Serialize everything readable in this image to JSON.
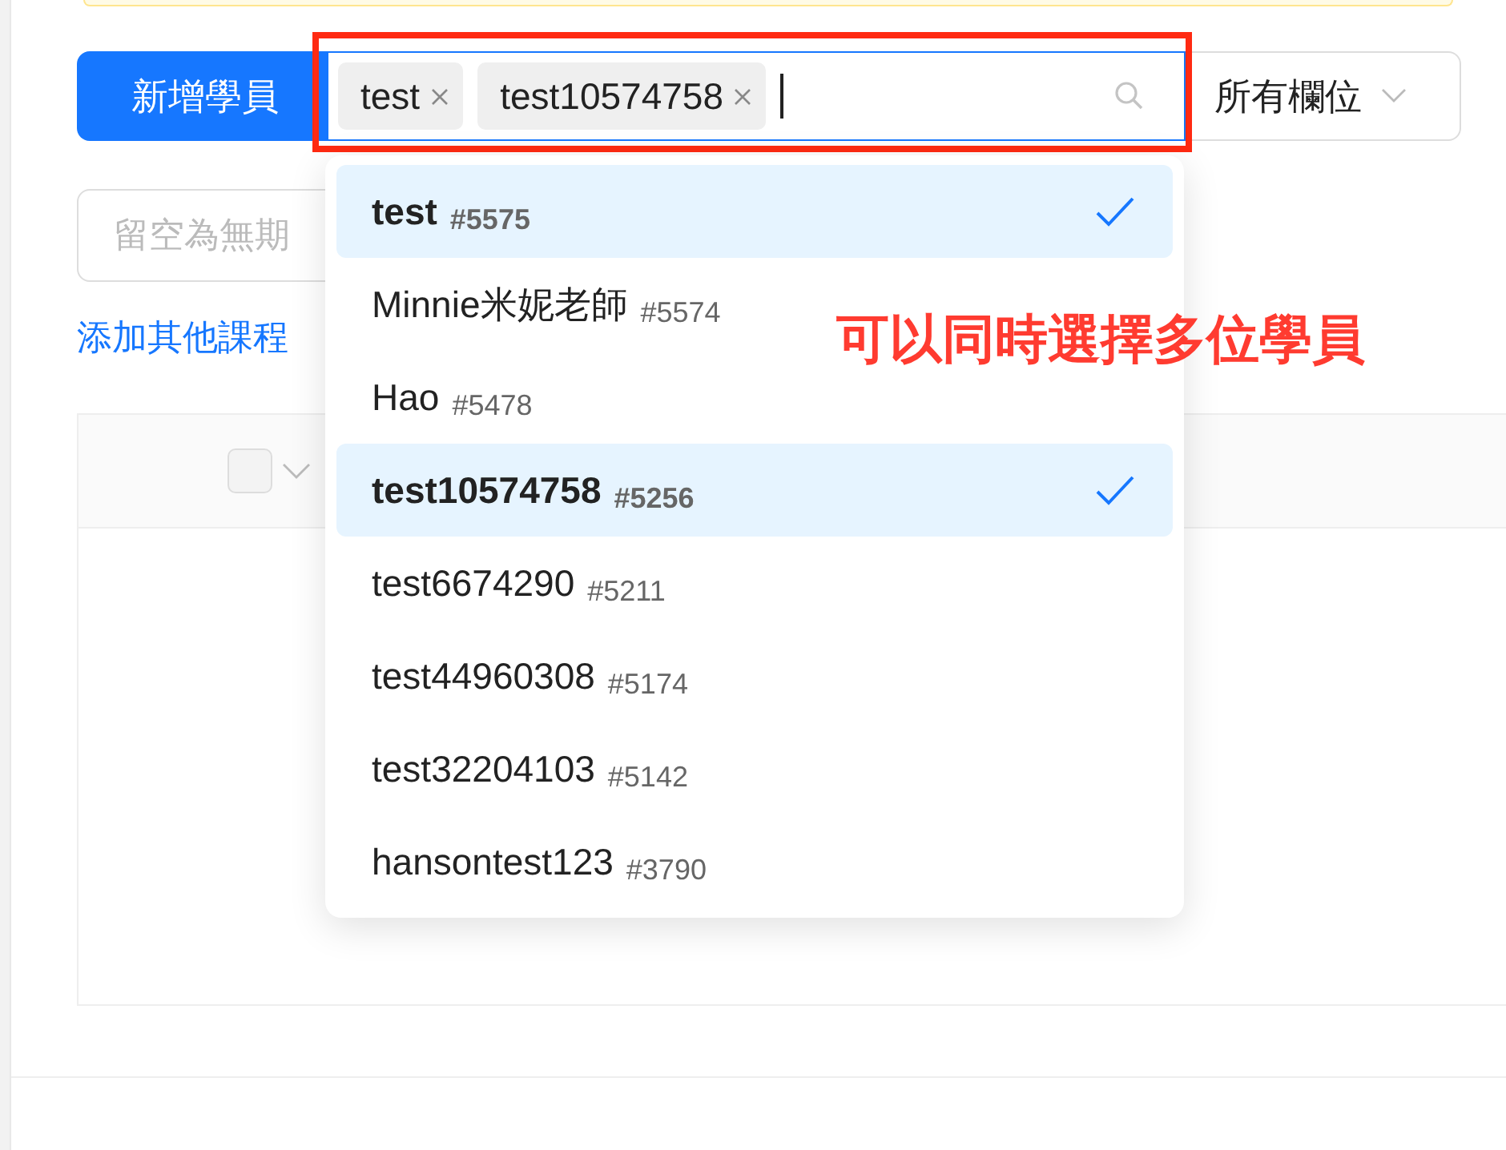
{
  "toolbar": {
    "add_button": "新增學員",
    "student_select": {
      "tags": [
        {
          "label": "test"
        },
        {
          "label": "test10574758"
        }
      ]
    },
    "column_select": {
      "value": "所有欄位"
    }
  },
  "date_field": {
    "placeholder": "留空為無期"
  },
  "add_course_link": "添加其他課程",
  "table": {
    "header_checkbox": {
      "checked": false
    }
  },
  "dropdown": {
    "options": [
      {
        "name": "test",
        "id": "#5575",
        "selected": true
      },
      {
        "name": "Minnie米妮老師",
        "id": "#5574",
        "selected": false
      },
      {
        "name": "Hao",
        "id": "#5478",
        "selected": false
      },
      {
        "name": "test10574758",
        "id": "#5256",
        "selected": true
      },
      {
        "name": "test6674290",
        "id": "#5211",
        "selected": false
      },
      {
        "name": "test44960308",
        "id": "#5174",
        "selected": false
      },
      {
        "name": "test32204103",
        "id": "#5142",
        "selected": false
      },
      {
        "name": "hansontest123",
        "id": "#3790",
        "selected": false
      }
    ]
  },
  "annotation": {
    "text": "可以同時選擇多位學員"
  }
}
